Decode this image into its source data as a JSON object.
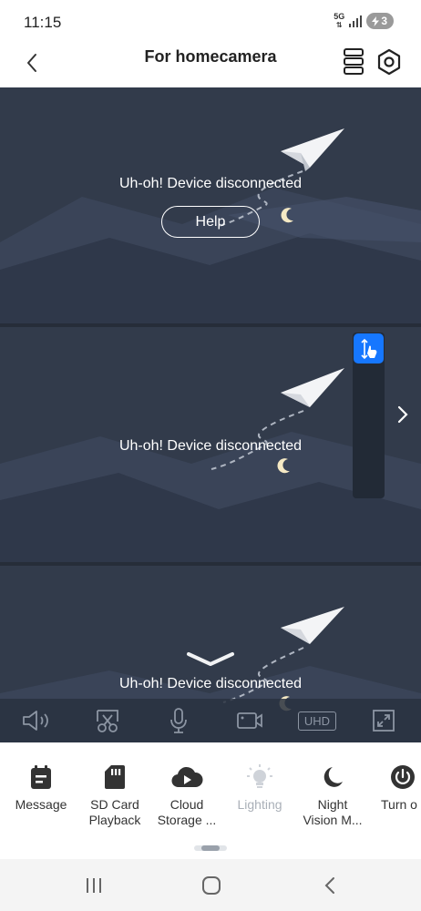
{
  "status_bar": {
    "time": "11:15",
    "network": "5G",
    "battery": "3"
  },
  "header": {
    "title": "For homecamera"
  },
  "feeds": [
    {
      "message": "Uh-oh! Device disconnected",
      "help_label": "Help"
    },
    {
      "message": "Uh-oh! Device disconnected"
    },
    {
      "message": "Uh-oh! Device disconnected"
    }
  ],
  "controls": {
    "quality_label": "UHD"
  },
  "toolbar": {
    "items": [
      {
        "label": "Message",
        "icon": "message-icon"
      },
      {
        "label": "SD Card\nPlayback",
        "icon": "sd-card-icon"
      },
      {
        "label": "Cloud\nStorage ...",
        "icon": "cloud-play-icon"
      },
      {
        "label": "Lighting",
        "icon": "lightbulb-icon",
        "disabled": true
      },
      {
        "label": "Night\nVision M...",
        "icon": "moon-icon"
      },
      {
        "label": "Turn o",
        "icon": "power-icon"
      }
    ]
  },
  "colors": {
    "feed_bg": "#323b4b",
    "accent": "#1677ff",
    "text_dark": "#333333"
  }
}
